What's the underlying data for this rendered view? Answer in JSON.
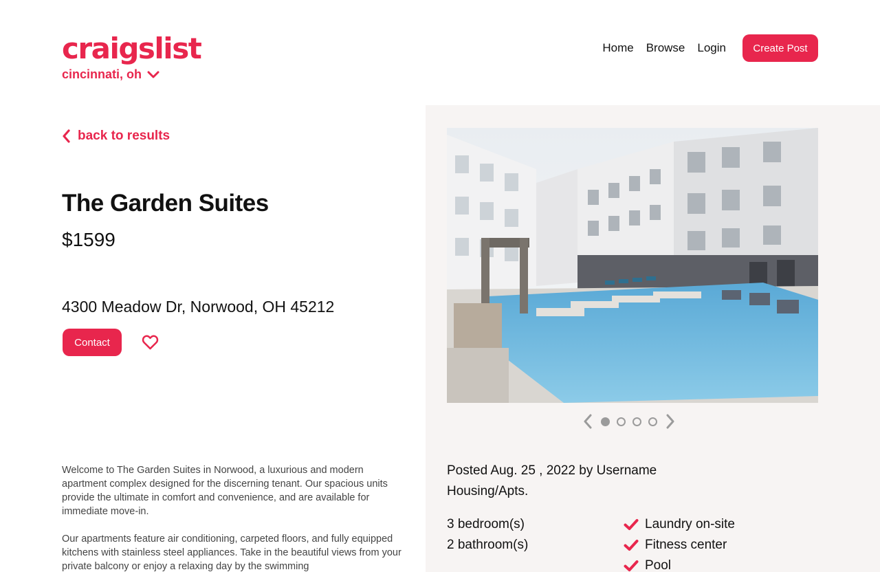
{
  "header": {
    "logo": "craigslist",
    "city": "cincinnati, oh",
    "nav": [
      "Home",
      "Browse",
      "Login"
    ],
    "create_label": "Create Post"
  },
  "listing": {
    "back_label": "back to results",
    "title": "The Garden Suites",
    "price": "$1599",
    "address": "4300 Meadow Dr, Norwood, OH 45212",
    "contact_label": "Contact",
    "description": [
      "Welcome to The Garden Suites in Norwood, a luxurious and modern apartment complex designed for the discerning tenant. Our spacious units provide the ultimate in comfort and convenience, and are available for immediate move-in.",
      "Our apartments feature air conditioning, carpeted floors, and fully equipped kitchens with stainless steel appliances. Take in the beautiful views from your private balcony or enjoy a relaxing day by the swimming"
    ]
  },
  "gallery": {
    "image_count": 4,
    "active_index": 0
  },
  "details": {
    "posted": "Posted Aug. 25 , 2022 by Username",
    "category": "Housing/Apts.",
    "specs": [
      "3 bedroom(s)",
      "2 bathroom(s)"
    ],
    "amenities": [
      "Laundry on-site",
      "Fitness center",
      "Pool"
    ]
  },
  "colors": {
    "accent": "#e8264d",
    "panel_bg": "#f7f4f3",
    "dot": "#9b9b9b"
  }
}
